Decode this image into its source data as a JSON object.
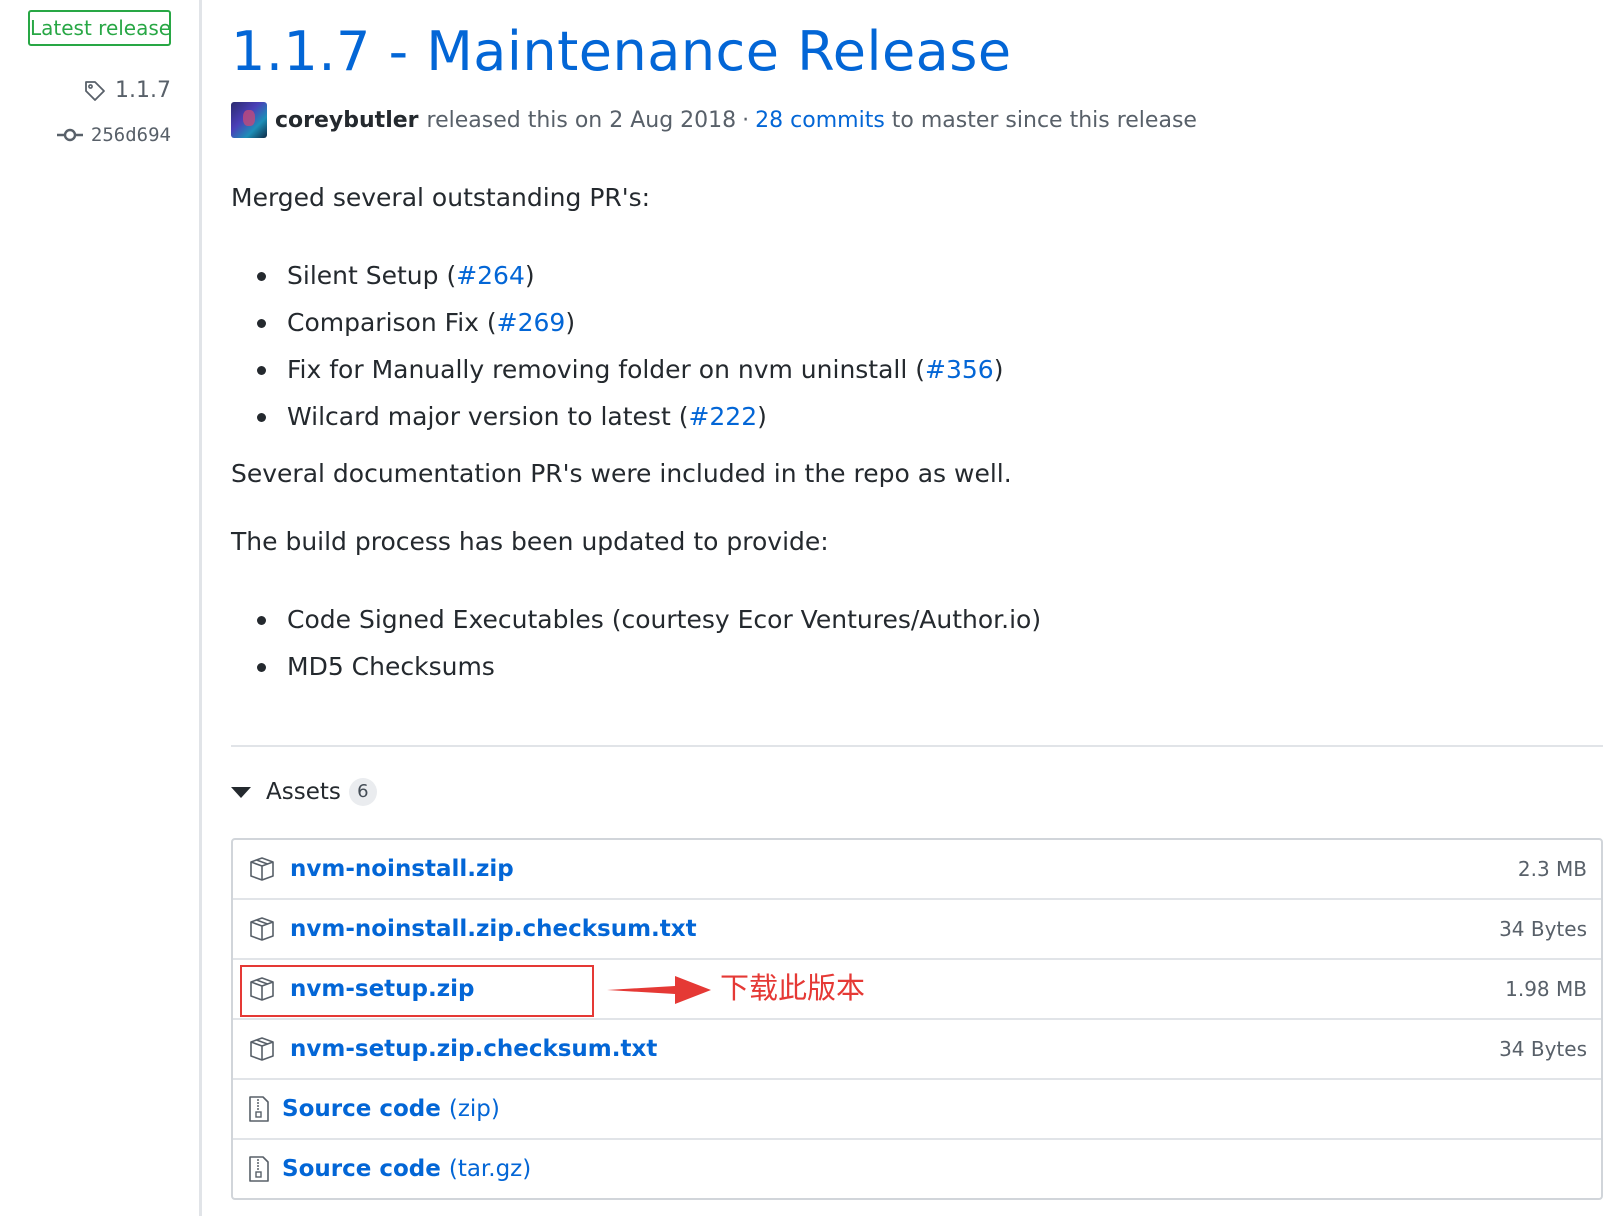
{
  "sidebar": {
    "latest_badge": "Latest release",
    "tag": "1.1.7",
    "commit": "256d694"
  },
  "release": {
    "title": "1.1.7 - Maintenance Release",
    "author": "coreybutler",
    "released_text": "released this on 2 Aug 2018",
    "separator": "·",
    "commits_link": "28 commits",
    "commits_suffix": "to master since this release"
  },
  "body": {
    "intro": "Merged several outstanding PR's:",
    "pr_items": [
      {
        "text": "Silent Setup (",
        "link": "#264",
        "close": ")"
      },
      {
        "text": "Comparison Fix (",
        "link": "#269",
        "close": ")"
      },
      {
        "text": "Fix for Manually removing folder on nvm uninstall (",
        "link": "#356",
        "close": ")"
      },
      {
        "text": "Wilcard major version to latest (",
        "link": "#222",
        "close": ")"
      }
    ],
    "docs_note": "Several documentation PR's were included in the repo as well.",
    "build_intro": "The build process has been updated to provide:",
    "build_items": [
      "Code Signed Executables (courtesy Ecor Ventures/Author.io)",
      "MD5 Checksums"
    ]
  },
  "assets": {
    "label": "Assets",
    "count": "6",
    "items": [
      {
        "name": "nvm-noinstall.zip",
        "size": "2.3 MB"
      },
      {
        "name": "nvm-noinstall.zip.checksum.txt",
        "size": "34 Bytes"
      },
      {
        "name": "nvm-setup.zip",
        "size": "1.98 MB"
      },
      {
        "name": "nvm-setup.zip.checksum.txt",
        "size": "34 Bytes"
      }
    ],
    "sources": [
      {
        "name": "Source code",
        "suffix": "(zip)"
      },
      {
        "name": "Source code",
        "suffix": "(tar.gz)"
      }
    ]
  },
  "annotation": {
    "text": "下载此版本",
    "color": "#e53935"
  },
  "colors": {
    "link": "#0366d6",
    "badge_green": "#28a745",
    "text": "#24292e",
    "muted": "#586069"
  }
}
